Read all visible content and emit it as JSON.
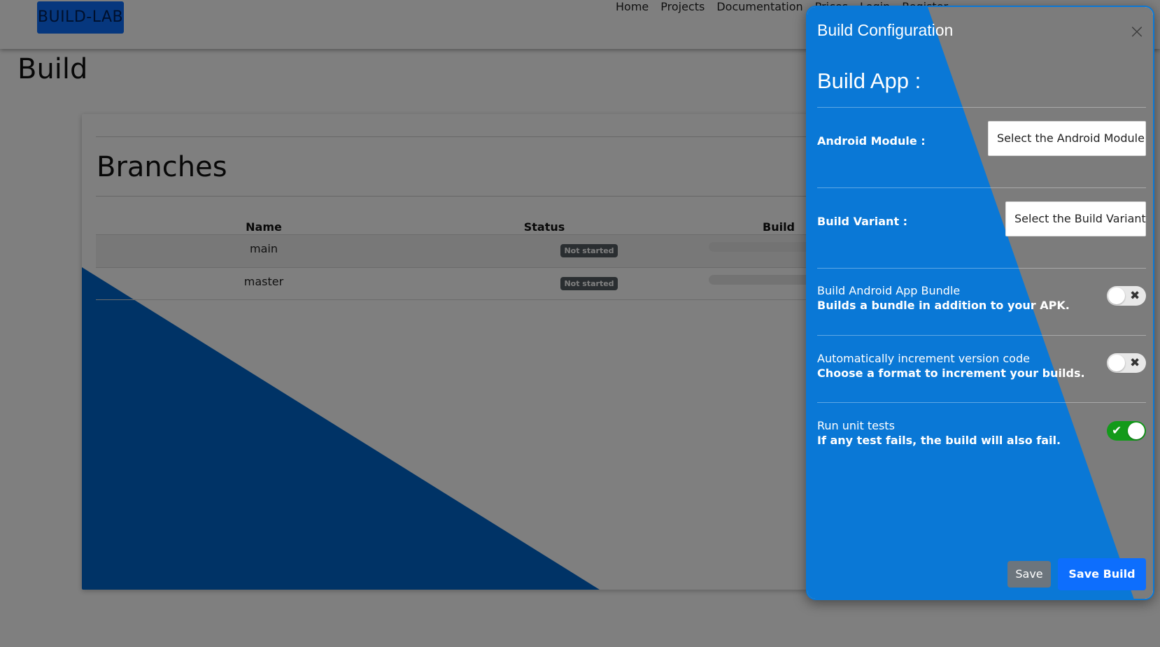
{
  "navbar": {
    "brand": "BUILD-LAB",
    "links": [
      "Home",
      "Projects",
      "Documentation",
      "Prices",
      "Login",
      "Register"
    ]
  },
  "page": {
    "title": "Build"
  },
  "branches": {
    "title": "Branches",
    "columns": [
      "Name",
      "Status",
      "Build"
    ],
    "rows": [
      {
        "name": "main",
        "status": "Not started",
        "progress": 0
      },
      {
        "name": "master",
        "status": "Not started",
        "progress": 0
      }
    ]
  },
  "panel": {
    "title": "Build Configuration",
    "close_icon": "close-icon",
    "heading": "Build App :",
    "android_module": {
      "label": "Android Module :",
      "value": "Select the Android Module"
    },
    "build_variant": {
      "label": "Build Variant :",
      "value": "Select the Build Variant"
    },
    "options": [
      {
        "title": "Build Android App Bundle",
        "desc": "Builds a bundle in addition to your APK.",
        "enabled": false
      },
      {
        "title": "Automatically increment version code",
        "desc": "Choose a format to increment your builds.",
        "enabled": false
      },
      {
        "title": "Run unit tests",
        "desc": "If any test fails, the build will also fail.",
        "enabled": true
      }
    ],
    "save_label": "Save",
    "save_build_label": "Save Build"
  },
  "colors": {
    "primary": "#0d6efd",
    "panel_blue": "#0a78d6",
    "decor_blue": "#0066cc",
    "toggle_on": "#139a1a",
    "badge": "#555c63"
  }
}
